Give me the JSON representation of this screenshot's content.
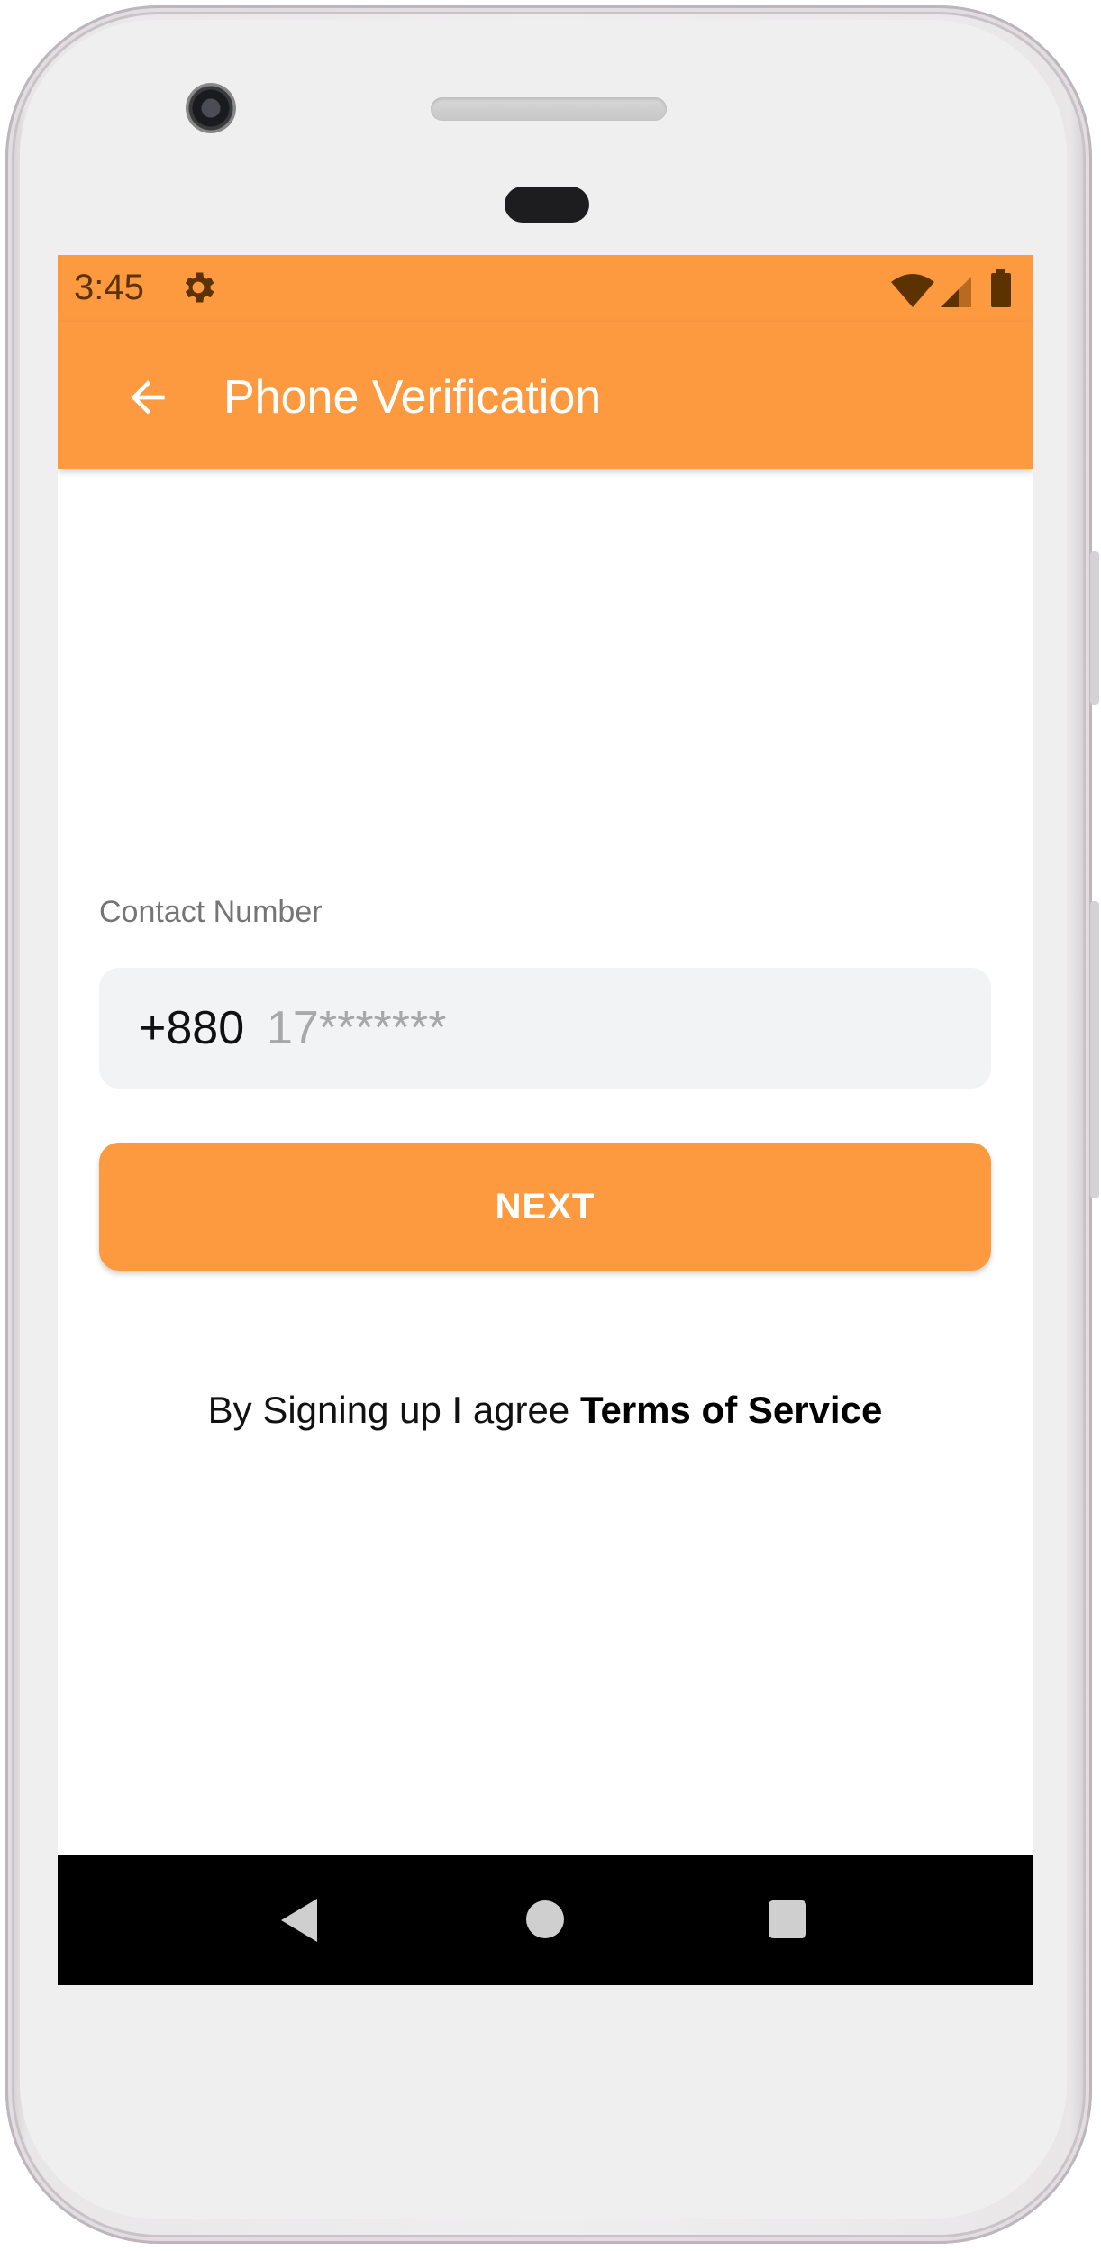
{
  "status_bar": {
    "time": "3:45",
    "icons": [
      "gear-icon",
      "wifi-icon",
      "signal-icon",
      "battery-icon"
    ]
  },
  "app_bar": {
    "title": "Phone Verification",
    "back_icon": "arrow-left-icon"
  },
  "form": {
    "contact_label": "Contact Number",
    "country_code": "+880",
    "phone_placeholder": "17*******",
    "phone_value": ""
  },
  "next_button": {
    "label": "NEXT"
  },
  "terms": {
    "prefix": "By Signing up I agree ",
    "link": "Terms of Service"
  },
  "nav_bar": {
    "icons": [
      "nav-back-icon",
      "nav-home-icon",
      "nav-recents-icon"
    ]
  },
  "colors": {
    "accent": "#fd993e",
    "status_text": "#5c3200",
    "field_bg": "#f2f3f5",
    "nav_bg": "#000000"
  }
}
